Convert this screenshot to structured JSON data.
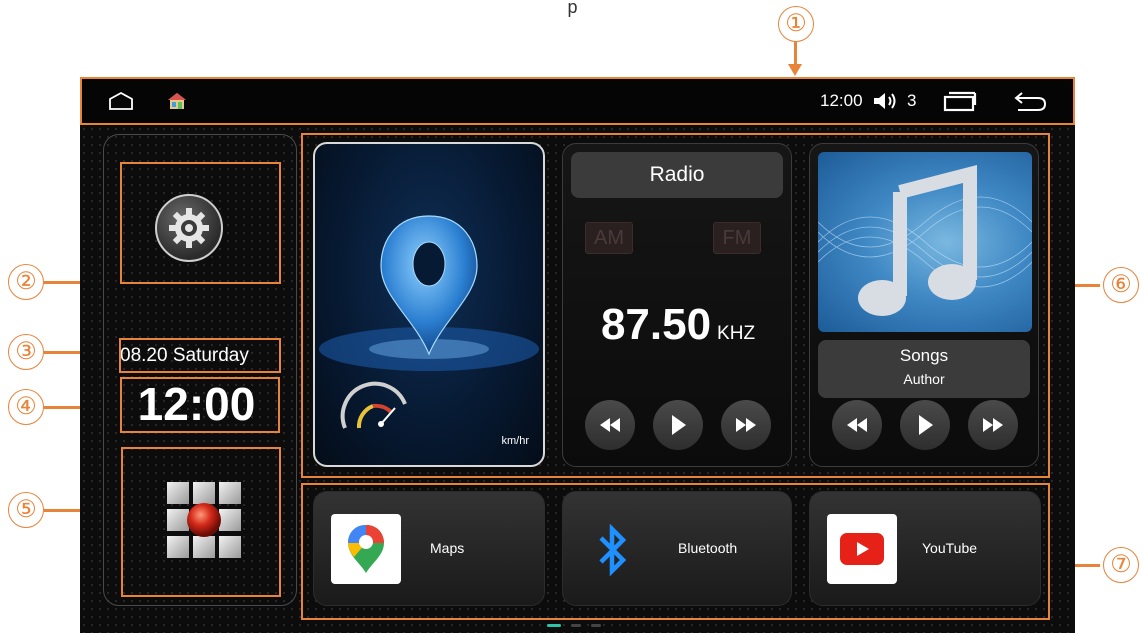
{
  "status_bar": {
    "home_icon": "home-outline-icon",
    "launcher_icon": "house-app-icon",
    "time": "12:00",
    "volume_icon": "speaker-icon",
    "volume_level": "3",
    "recents_icon": "recent-apps-icon",
    "back_icon": "back-arrow-icon"
  },
  "sidebar": {
    "settings_icon": "gear-icon",
    "date": "08.20 Saturday",
    "clock": "12:00",
    "apps_icon": "app-grid-icon"
  },
  "navigation_card": {
    "speed_unit": "km/hr",
    "icon": "map-pin-icon"
  },
  "radio_card": {
    "title": "Radio",
    "band_am": "AM",
    "band_fm": "FM",
    "frequency": "87.50",
    "frequency_unit": "KHZ"
  },
  "music_card": {
    "song_title": "Songs",
    "song_author": "Author",
    "icon": "music-note-icon"
  },
  "apps": [
    {
      "label": "Maps",
      "icon": "google-maps-icon"
    },
    {
      "label": "Bluetooth",
      "icon": "bluetooth-icon"
    },
    {
      "label": "YouTube",
      "icon": "youtube-icon"
    }
  ],
  "callouts": [
    "①",
    "②",
    "③",
    "④",
    "⑤",
    "⑥",
    "⑦"
  ],
  "colors": {
    "accent": "#e8833a",
    "background": "#0c0c0c",
    "panel": "#3b3b3b"
  }
}
